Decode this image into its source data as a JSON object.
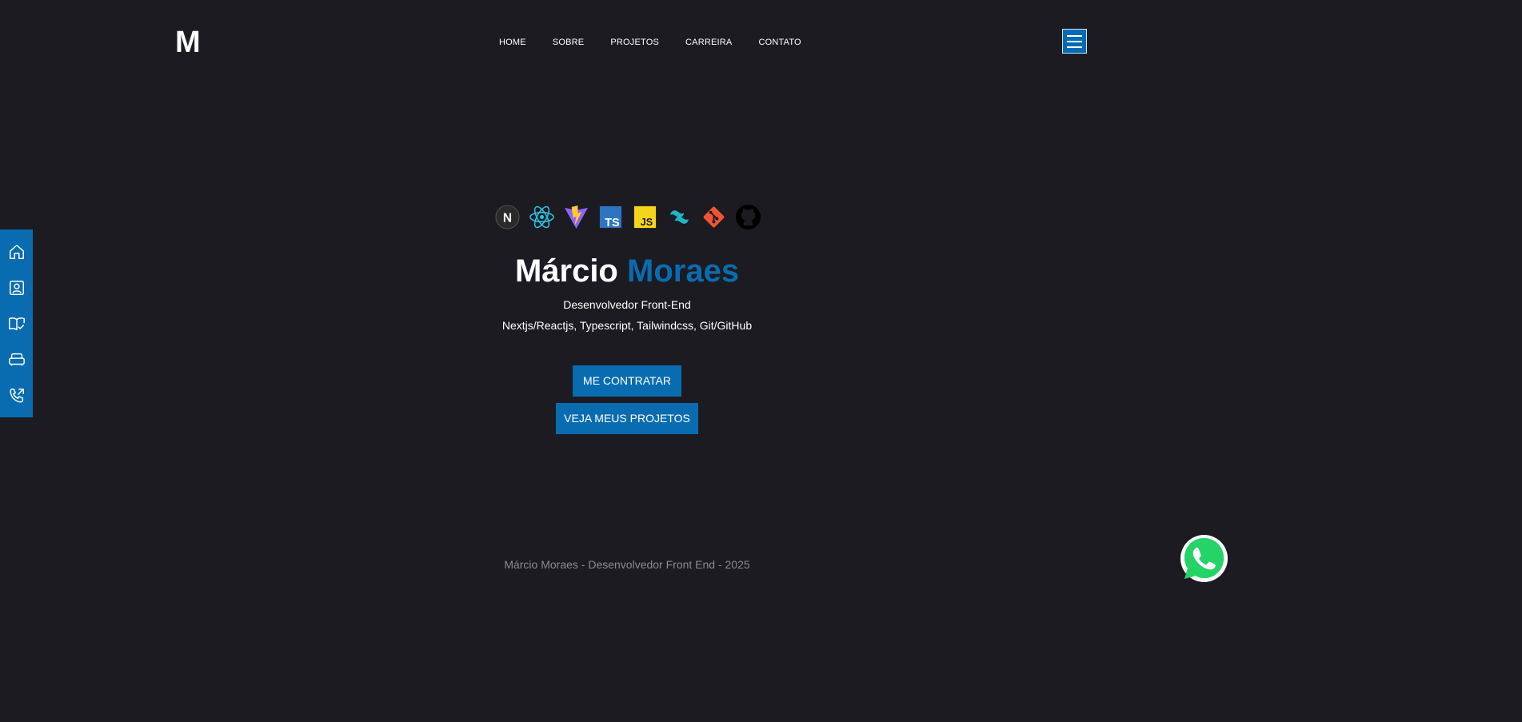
{
  "header": {
    "logo": "M",
    "nav": [
      "HOME",
      "SOBRE",
      "PROJETOS",
      "CARREIRA",
      "CONTATO"
    ]
  },
  "sidebar": {
    "items": [
      {
        "icon": "home-icon"
      },
      {
        "icon": "contact-card-icon"
      },
      {
        "icon": "book-check-icon"
      },
      {
        "icon": "briefcase-icon"
      },
      {
        "icon": "phone-outgoing-icon"
      }
    ]
  },
  "hero": {
    "tech_icons": [
      "nextjs-icon",
      "react-icon",
      "vite-icon",
      "typescript-icon",
      "javascript-icon",
      "tailwind-icon",
      "git-icon",
      "github-icon"
    ],
    "ts_label": "TS",
    "js_label": "JS",
    "n_label": "N",
    "first_name": "Márcio",
    "last_name": "Moraes",
    "subtitle": "Desenvolvedor Front-End",
    "stack": "Nextjs/Reactjs, Typescript, Tailwindcss, Git/GitHub",
    "hire_button": "ME CONTRATAR",
    "projects_button": "VEJA MEUS PROJETOS"
  },
  "footer": {
    "text": "Márcio Moraes - Desenvolvedor Front End - 2025"
  },
  "colors": {
    "background": "#1b1b21",
    "accent": "#0a6cb0",
    "footer_text": "#8a8a90"
  }
}
